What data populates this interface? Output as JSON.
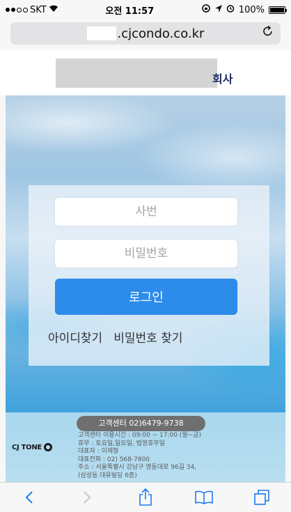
{
  "status_bar": {
    "carrier": "SKT",
    "wifi_icon": "wifi-icon",
    "time": "오전 11:57",
    "battery": "100%"
  },
  "address_bar": {
    "url": ".cjcondo.co.kr",
    "reload_icon": "reload-icon"
  },
  "site_header": {
    "logo_suffix": "회사"
  },
  "login": {
    "id_placeholder": "사번",
    "pw_placeholder": "비밀번호",
    "login_label": "로그인",
    "find_id": "아이디찾기",
    "find_pw": "비밀번호 찾기"
  },
  "footer": {
    "cs_label": "고객센터 02)6479-9738",
    "info_lines": [
      "고객센터 이용시간 : 09:00 ~ 17:00 (월~금)",
      "휴무 : 토요일,일요일, 법정휴무일",
      "대표자 : 이재형",
      "대표전화 : 02) 568-7800",
      "주소 : 서울특별시 강남구 영동대로 96길 34,",
      "(삼성동 대유빌딩 6층)"
    ],
    "logo_text": "CJ TONE"
  },
  "toolbar": {
    "back_icon": "chevron-left-icon",
    "forward_icon": "chevron-right-icon",
    "share_icon": "share-icon",
    "bookmarks_icon": "book-icon",
    "tabs_icon": "tabs-icon"
  },
  "colors": {
    "accent": "#2d8bea",
    "ios_blue": "#1a7bf2",
    "cs_pill": "#6f6f6f"
  }
}
